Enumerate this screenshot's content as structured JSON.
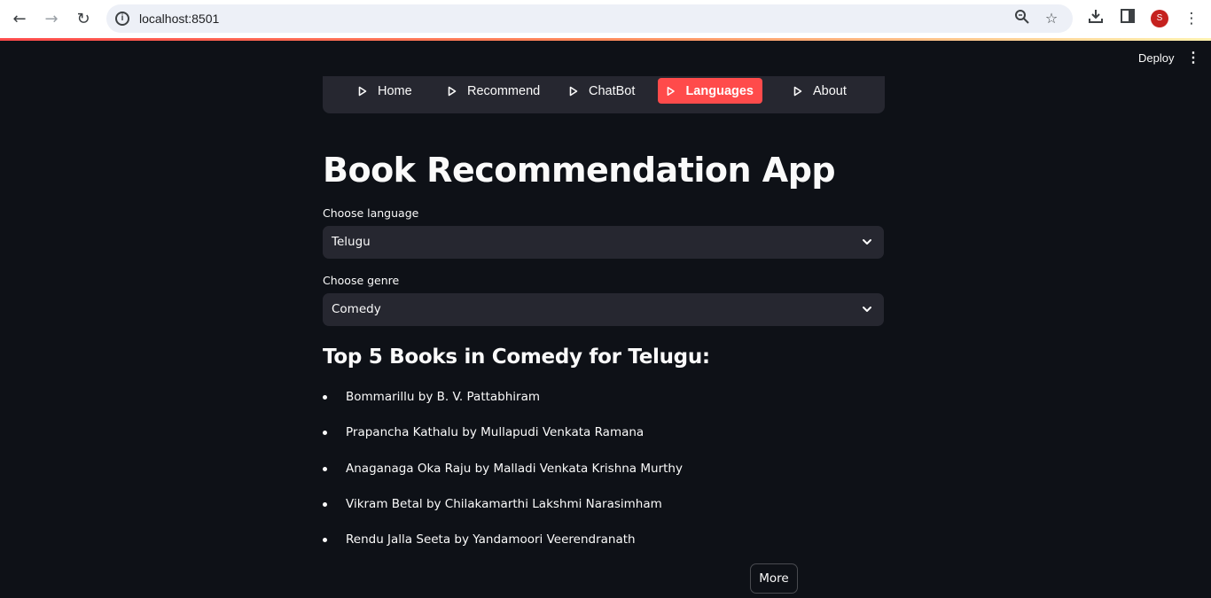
{
  "browser": {
    "url": "localhost:8501",
    "avatar_letter": "S",
    "icons": [
      "back-icon",
      "forward-icon",
      "reload-icon",
      "site-info-icon",
      "zoom-icon",
      "bookmark-star-icon",
      "download-icon",
      "side-panel-icon",
      "browser-menu-icon"
    ]
  },
  "header": {
    "deploy_label": "Deploy"
  },
  "menu": {
    "items": [
      {
        "label": "Home",
        "active": false
      },
      {
        "label": "Recommend",
        "active": false
      },
      {
        "label": "ChatBot",
        "active": false
      },
      {
        "label": "Languages",
        "active": true
      },
      {
        "label": "About",
        "active": false
      }
    ],
    "active_color": "#ff4b4b"
  },
  "main": {
    "title": "Book Recommendation App",
    "language_label": "Choose language",
    "language_value": "Telugu",
    "genre_label": "Choose genre",
    "genre_value": "Comedy",
    "results_heading": "Top 5 Books in Comedy for Telugu:",
    "books": [
      "Bommarillu by B. V. Pattabhiram",
      "Prapancha Kathalu by Mullapudi Venkata Ramana",
      "Anaganaga Oka Raju by Malladi Venkata Krishna Murthy",
      "Vikram Betal by Chilakamarthi Lakshmi Narasimham",
      "Rendu Jalla Seeta by Yandamoori Veerendranath"
    ],
    "more_label": "More"
  },
  "colors": {
    "background": "#0e1117",
    "widget": "#262730",
    "accent": "#ff4b4b",
    "text": "#fafafa"
  }
}
